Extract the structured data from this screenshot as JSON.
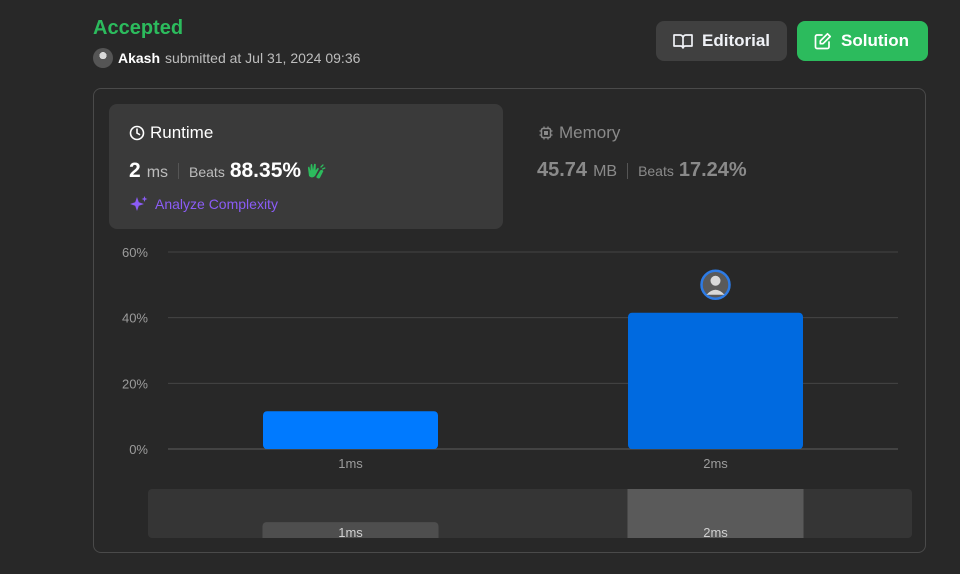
{
  "header": {
    "status": "Accepted",
    "submitter_name": "Akash",
    "submitted_text": "submitted at Jul 31, 2024 09:36"
  },
  "buttons": {
    "editorial_label": "Editorial",
    "solution_label": "Solution"
  },
  "runtime": {
    "title": "Runtime",
    "value": "2",
    "unit": "ms",
    "beats_label": "Beats",
    "beats_value": "88.35%",
    "analyze_label": "Analyze Complexity"
  },
  "memory": {
    "title": "Memory",
    "value": "45.74",
    "unit": "MB",
    "beats_label": "Beats",
    "beats_value": "17.24%"
  },
  "colors": {
    "accepted": "#2cbb5d",
    "solution_button": "#2cbb5d",
    "bar": "#007aff",
    "bar_active": "#006ae0",
    "analyze": "#8b5cf6"
  },
  "icons": {
    "editorial": "book-icon",
    "solution": "edit-icon",
    "runtime": "clock-icon",
    "memory": "chip-icon",
    "beats": "clap-hands-icon",
    "analyze": "sparkle-icon"
  },
  "chart_data": {
    "type": "bar",
    "categories": [
      "1ms",
      "2ms"
    ],
    "values": [
      11.5,
      41.5
    ],
    "highlight_category": "2ms",
    "y_ticks": [
      "0%",
      "20%",
      "40%",
      "60%"
    ],
    "ylim": [
      0,
      60
    ],
    "grid": true
  },
  "navigator": {
    "categories": [
      "1ms",
      "2ms"
    ],
    "values": [
      11.5,
      41.5
    ]
  }
}
